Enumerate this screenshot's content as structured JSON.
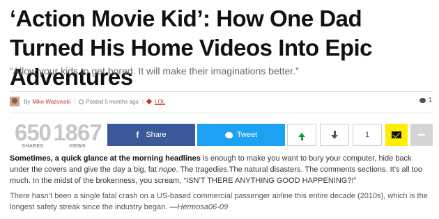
{
  "article": {
    "title": "‘Action Movie Kid’: How One Dad Turned His Home Videos Into Epic Adventures",
    "subtitle": "“Allow your kids to get bored. It will make their imaginations better.”",
    "byline": {
      "by": "By",
      "author": "Mike Wazowski",
      "posted": "Posted 5 months ago",
      "category": "LOL"
    },
    "comment_count": "1"
  },
  "stats": {
    "shares_value": "650",
    "shares_label": "SHARES",
    "views_value": "1867",
    "views_label": "VIEWS"
  },
  "share": {
    "facebook_label": "Share",
    "twitter_label": "Tweet",
    "vote_count": "1"
  },
  "body": {
    "p1_lead": "Sometimes, a quick glance at the morning headlines",
    "p1_a": " is enough to make you want to bury your computer, hide back under the covers and give the day a big, fat ",
    "p1_em": "nope",
    "p1_b": ". The tragedies.The natural disasters. The comments sections. It’s all too much. In the midst of the brokenness, you scream, “ISN’T THERE ANYTHING GOOD HAPPENING?!”",
    "p2_a": "There hasn’t been a single fatal crash on a US-based commercial passenger airline this entire decade (2010s), which is the longest safety streak since the industry began. ",
    "p2_em": "—Hermosa06-09"
  },
  "colors": {
    "facebook": "#3b5998",
    "twitter": "#1da1f2",
    "mail": "#ffec00",
    "upvote": "#1a9a3c",
    "accent": "#c0392b"
  }
}
